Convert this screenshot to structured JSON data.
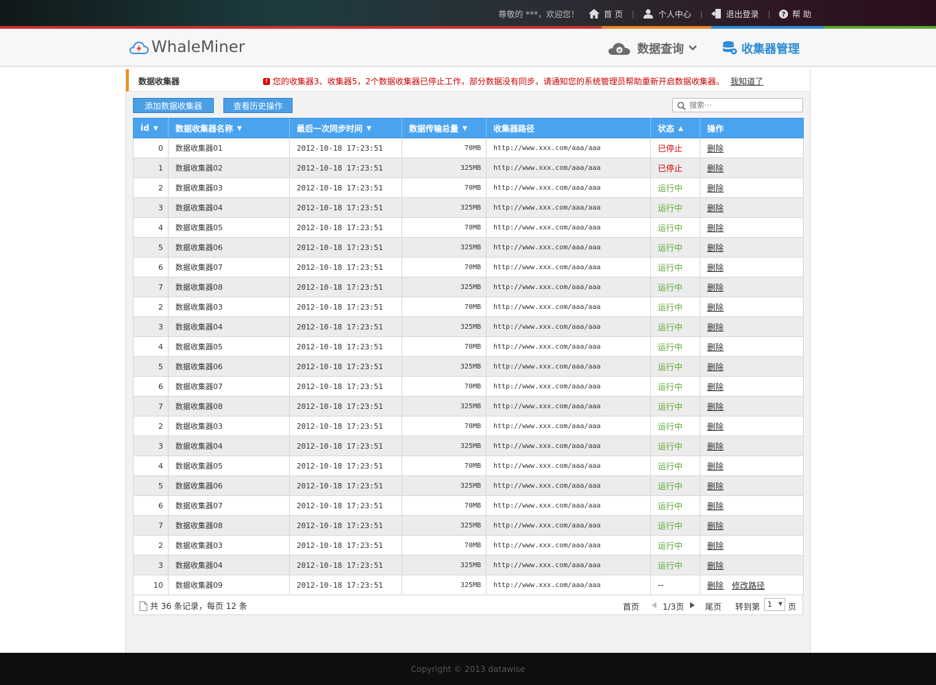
{
  "topbar": {
    "greeting": "尊敬的 ***，欢迎您！",
    "home": "首 页",
    "profile": "个人中心",
    "logout": "退出登录",
    "help": "帮 助",
    "separator": "|"
  },
  "colors": {
    "accent": "#4aa3ef",
    "orange": "#f08a24",
    "stopped": "#d40000",
    "running": "#5aa832",
    "line": [
      "#c9332b",
      "#f08a24",
      "#2c8bd6",
      "#5aa832"
    ]
  },
  "header": {
    "logo": "WhaleMiner",
    "nav_query": "数据查询",
    "nav_collector": "收集器管理"
  },
  "title": {
    "text": "数据收集器",
    "alert": "您的收集器3、收集器5，2个数据收集器已停止工作，部分数据没有同步，请通知您的系统管理员帮助重新开启数据收集器。",
    "alert_icon": "!",
    "dismiss": "我知道了"
  },
  "toolbar": {
    "add_label": "添加数据收集器",
    "history_label": "查看历史操作",
    "search_placeholder": "搜索···"
  },
  "table": {
    "headers": [
      {
        "label": "id",
        "arrow": "▼"
      },
      {
        "label": "数据收集器名称",
        "arrow": "▼"
      },
      {
        "label": "最后一次同步时间",
        "arrow": "▼"
      },
      {
        "label": "数据传输总量",
        "arrow": "▼"
      },
      {
        "label": "收集器路径",
        "arrow": ""
      },
      {
        "label": "状态",
        "arrow": "▲"
      },
      {
        "label": "操作",
        "arrow": ""
      }
    ],
    "rows": [
      {
        "id": "0",
        "name": "数据收集器01",
        "time": "2012-10-18 17:23:51",
        "size": "70MB",
        "url": "http://www.xxx.com/aaa/aaa",
        "status": "已停止",
        "state": "stop",
        "ops": [
          "删除"
        ]
      },
      {
        "id": "1",
        "name": "数据收集器02",
        "time": "2012-10-18 17:23:51",
        "size": "325MB",
        "url": "http://www.xxx.com/aaa/aaa",
        "status": "已停止",
        "state": "stop",
        "ops": [
          "删除"
        ]
      },
      {
        "id": "2",
        "name": "数据收集器03",
        "time": "2012-10-18 17:23:51",
        "size": "70MB",
        "url": "http://www.xxx.com/aaa/aaa",
        "status": "运行中",
        "state": "run",
        "ops": [
          "删除"
        ]
      },
      {
        "id": "3",
        "name": "数据收集器04",
        "time": "2012-10-18 17:23:51",
        "size": "325MB",
        "url": "http://www.xxx.com/aaa/aaa",
        "status": "运行中",
        "state": "run",
        "ops": [
          "删除"
        ]
      },
      {
        "id": "4",
        "name": "数据收集器05",
        "time": "2012-10-18 17:23:51",
        "size": "70MB",
        "url": "http://www.xxx.com/aaa/aaa",
        "status": "运行中",
        "state": "run",
        "ops": [
          "删除"
        ]
      },
      {
        "id": "5",
        "name": "数据收集器06",
        "time": "2012-10-18 17:23:51",
        "size": "325MB",
        "url": "http://www.xxx.com/aaa/aaa",
        "status": "运行中",
        "state": "run",
        "ops": [
          "删除"
        ]
      },
      {
        "id": "6",
        "name": "数据收集器07",
        "time": "2012-10-18 17:23:51",
        "size": "70MB",
        "url": "http://www.xxx.com/aaa/aaa",
        "status": "运行中",
        "state": "run",
        "ops": [
          "删除"
        ]
      },
      {
        "id": "7",
        "name": "数据收集器08",
        "time": "2012-10-18 17:23:51",
        "size": "325MB",
        "url": "http://www.xxx.com/aaa/aaa",
        "status": "运行中",
        "state": "run",
        "ops": [
          "删除"
        ]
      },
      {
        "id": "2",
        "name": "数据收集器03",
        "time": "2012-10-18 17:23:51",
        "size": "70MB",
        "url": "http://www.xxx.com/aaa/aaa",
        "status": "运行中",
        "state": "run",
        "ops": [
          "删除"
        ]
      },
      {
        "id": "3",
        "name": "数据收集器04",
        "time": "2012-10-18 17:23:51",
        "size": "325MB",
        "url": "http://www.xxx.com/aaa/aaa",
        "status": "运行中",
        "state": "run",
        "ops": [
          "删除"
        ]
      },
      {
        "id": "4",
        "name": "数据收集器05",
        "time": "2012-10-18 17:23:51",
        "size": "70MB",
        "url": "http://www.xxx.com/aaa/aaa",
        "status": "运行中",
        "state": "run",
        "ops": [
          "删除"
        ]
      },
      {
        "id": "5",
        "name": "数据收集器06",
        "time": "2012-10-18 17:23:51",
        "size": "325MB",
        "url": "http://www.xxx.com/aaa/aaa",
        "status": "运行中",
        "state": "run",
        "ops": [
          "删除"
        ]
      },
      {
        "id": "6",
        "name": "数据收集器07",
        "time": "2012-10-18 17:23:51",
        "size": "70MB",
        "url": "http://www.xxx.com/aaa/aaa",
        "status": "运行中",
        "state": "run",
        "ops": [
          "删除"
        ]
      },
      {
        "id": "7",
        "name": "数据收集器08",
        "time": "2012-10-18 17:23:51",
        "size": "325MB",
        "url": "http://www.xxx.com/aaa/aaa",
        "status": "运行中",
        "state": "run",
        "ops": [
          "删除"
        ]
      },
      {
        "id": "2",
        "name": "数据收集器03",
        "time": "2012-10-18 17:23:51",
        "size": "70MB",
        "url": "http://www.xxx.com/aaa/aaa",
        "status": "运行中",
        "state": "run",
        "ops": [
          "删除"
        ]
      },
      {
        "id": "3",
        "name": "数据收集器04",
        "time": "2012-10-18 17:23:51",
        "size": "325MB",
        "url": "http://www.xxx.com/aaa/aaa",
        "status": "运行中",
        "state": "run",
        "ops": [
          "删除"
        ]
      },
      {
        "id": "4",
        "name": "数据收集器05",
        "time": "2012-10-18 17:23:51",
        "size": "70MB",
        "url": "http://www.xxx.com/aaa/aaa",
        "status": "运行中",
        "state": "run",
        "ops": [
          "删除"
        ]
      },
      {
        "id": "5",
        "name": "数据收集器06",
        "time": "2012-10-18 17:23:51",
        "size": "325MB",
        "url": "http://www.xxx.com/aaa/aaa",
        "status": "运行中",
        "state": "run",
        "ops": [
          "删除"
        ]
      },
      {
        "id": "6",
        "name": "数据收集器07",
        "time": "2012-10-18 17:23:51",
        "size": "70MB",
        "url": "http://www.xxx.com/aaa/aaa",
        "status": "运行中",
        "state": "run",
        "ops": [
          "删除"
        ]
      },
      {
        "id": "7",
        "name": "数据收集器08",
        "time": "2012-10-18 17:23:51",
        "size": "325MB",
        "url": "http://www.xxx.com/aaa/aaa",
        "status": "运行中",
        "state": "run",
        "ops": [
          "删除"
        ]
      },
      {
        "id": "2",
        "name": "数据收集器03",
        "time": "2012-10-18 17:23:51",
        "size": "70MB",
        "url": "http://www.xxx.com/aaa/aaa",
        "status": "运行中",
        "state": "run",
        "ops": [
          "删除"
        ]
      },
      {
        "id": "3",
        "name": "数据收集器04",
        "time": "2012-10-18 17:23:51",
        "size": "325MB",
        "url": "http://www.xxx.com/aaa/aaa",
        "status": "运行中",
        "state": "run",
        "ops": [
          "删除"
        ]
      },
      {
        "id": "10",
        "name": "数据收集器09",
        "time": "2012-10-18 17:23:51",
        "size": "325MB",
        "url": "http://www.xxx.com/aaa/aaa",
        "status": "--",
        "state": "none",
        "ops": [
          "删除",
          "修改路径"
        ]
      }
    ]
  },
  "pager": {
    "total": "共 36 条记录，每页 12 条",
    "first": "首页",
    "current": "1/3页",
    "last": "尾页",
    "goto": "转到第",
    "page_value": "1",
    "page_unit": "页"
  },
  "footer": {
    "copyright": "Copyright © 2013 datawise"
  }
}
